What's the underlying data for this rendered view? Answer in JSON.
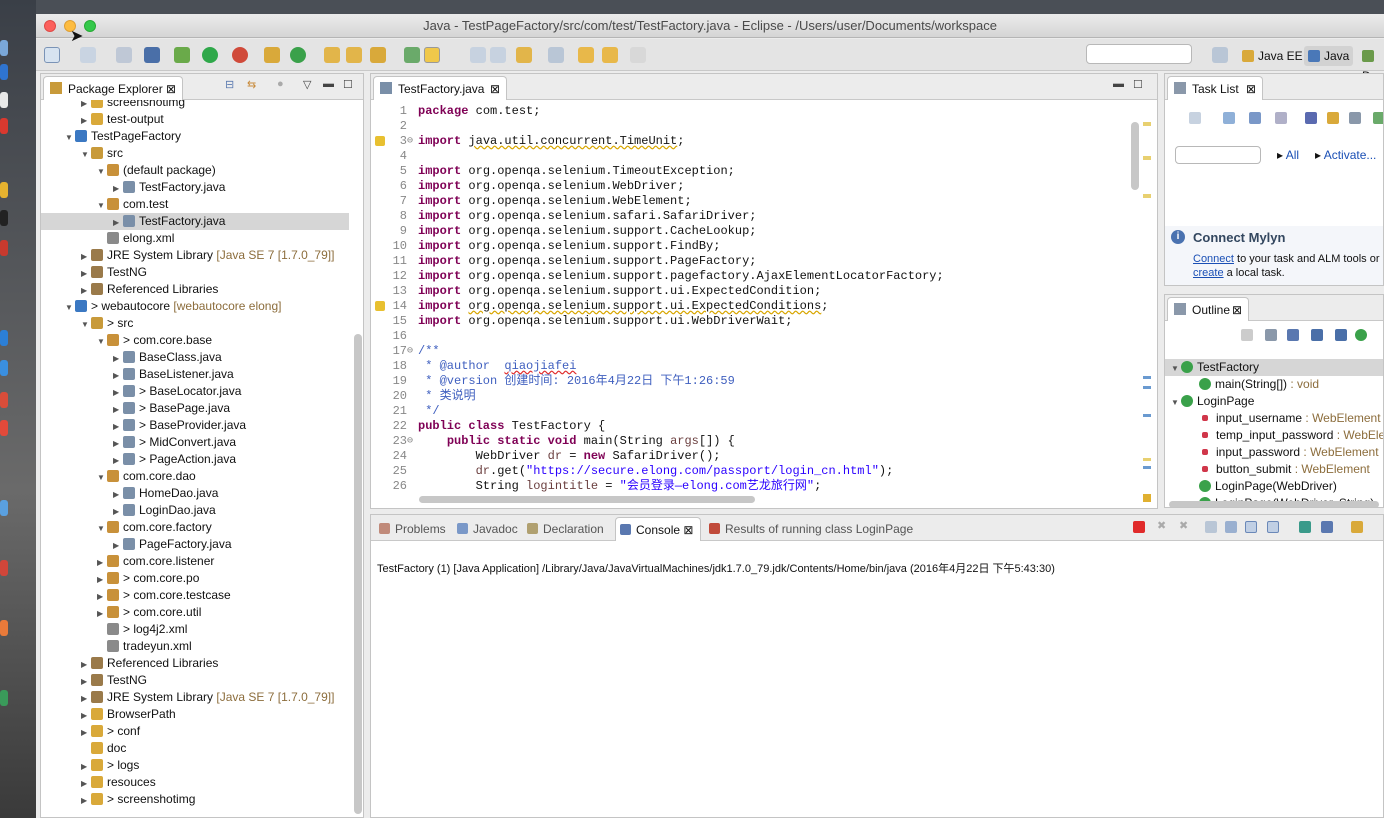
{
  "window": {
    "title": "Java - TestPageFactory/src/com/test/TestFactory.java - Eclipse - /Users/user/Documents/workspace"
  },
  "perspectives": {
    "java_ee": "Java EE",
    "java": "Java"
  },
  "package_explorer": {
    "tab": "Package Explorer",
    "rows": [
      {
        "indent": 2,
        "twisty": "▶",
        "label": "screenshotimg",
        "color": "#d9a93a"
      },
      {
        "indent": 2,
        "twisty": "▶",
        "label": "test-output",
        "color": "#d9a93a"
      },
      {
        "indent": 1,
        "twisty": "▼",
        "label": "TestPageFactory",
        "color": "#3b78c2"
      },
      {
        "indent": 2,
        "twisty": "▼",
        "label": "src",
        "color": "#c89a3a"
      },
      {
        "indent": 3,
        "twisty": "▼",
        "label": "(default package)",
        "color": "#c8913a"
      },
      {
        "indent": 4,
        "twisty": "▶",
        "label": "TestFactory.java",
        "color": "#7a8fa8"
      },
      {
        "indent": 3,
        "twisty": "▼",
        "label": "com.test",
        "color": "#c8913a"
      },
      {
        "indent": 4,
        "twisty": "▶",
        "label": "TestFactory.java",
        "color": "#7a8fa8",
        "selected": true
      },
      {
        "indent": 3,
        "twisty": "",
        "label": "elong.xml",
        "color": "#8a8a8a"
      },
      {
        "indent": 2,
        "twisty": "▶",
        "label": "JRE System Library",
        "deco": "[Java SE 7 [1.7.0_79]]",
        "color": "#9a7a4a"
      },
      {
        "indent": 2,
        "twisty": "▶",
        "label": "TestNG",
        "color": "#9a7a4a"
      },
      {
        "indent": 2,
        "twisty": "▶",
        "label": "Referenced Libraries",
        "color": "#9a7a4a"
      },
      {
        "indent": 1,
        "twisty": "▼",
        "label": "> webautocore",
        "deco": "[webautocore elong]",
        "color": "#3b78c2"
      },
      {
        "indent": 2,
        "twisty": "▼",
        "label": "> src",
        "color": "#c89a3a"
      },
      {
        "indent": 3,
        "twisty": "▼",
        "label": "> com.core.base",
        "color": "#c8913a"
      },
      {
        "indent": 4,
        "twisty": "▶",
        "label": "BaseClass.java",
        "color": "#7a8fa8"
      },
      {
        "indent": 4,
        "twisty": "▶",
        "label": "BaseListener.java",
        "color": "#7a8fa8"
      },
      {
        "indent": 4,
        "twisty": "▶",
        "label": "> BaseLocator.java",
        "color": "#7a8fa8"
      },
      {
        "indent": 4,
        "twisty": "▶",
        "label": "> BasePage.java",
        "color": "#7a8fa8"
      },
      {
        "indent": 4,
        "twisty": "▶",
        "label": "> BaseProvider.java",
        "color": "#7a8fa8"
      },
      {
        "indent": 4,
        "twisty": "▶",
        "label": "> MidConvert.java",
        "color": "#7a8fa8"
      },
      {
        "indent": 4,
        "twisty": "▶",
        "label": "> PageAction.java",
        "color": "#7a8fa8"
      },
      {
        "indent": 3,
        "twisty": "▼",
        "label": "com.core.dao",
        "color": "#c8913a"
      },
      {
        "indent": 4,
        "twisty": "▶",
        "label": "HomeDao.java",
        "color": "#7a8fa8"
      },
      {
        "indent": 4,
        "twisty": "▶",
        "label": "LoginDao.java",
        "color": "#7a8fa8"
      },
      {
        "indent": 3,
        "twisty": "▼",
        "label": "com.core.factory",
        "color": "#c8913a"
      },
      {
        "indent": 4,
        "twisty": "▶",
        "label": "PageFactory.java",
        "color": "#7a8fa8"
      },
      {
        "indent": 3,
        "twisty": "▶",
        "label": "com.core.listener",
        "color": "#c8913a"
      },
      {
        "indent": 3,
        "twisty": "▶",
        "label": "> com.core.po",
        "color": "#c8913a"
      },
      {
        "indent": 3,
        "twisty": "▶",
        "label": "> com.core.testcase",
        "color": "#c8913a"
      },
      {
        "indent": 3,
        "twisty": "▶",
        "label": "> com.core.util",
        "color": "#c8913a"
      },
      {
        "indent": 3,
        "twisty": "",
        "label": "> log4j2.xml",
        "color": "#8a8a8a"
      },
      {
        "indent": 3,
        "twisty": "",
        "label": "tradeyun.xml",
        "color": "#8a8a8a"
      },
      {
        "indent": 2,
        "twisty": "▶",
        "label": "Referenced Libraries",
        "color": "#9a7a4a"
      },
      {
        "indent": 2,
        "twisty": "▶",
        "label": "TestNG",
        "color": "#9a7a4a"
      },
      {
        "indent": 2,
        "twisty": "▶",
        "label": "JRE System Library",
        "deco": "[Java SE 7 [1.7.0_79]]",
        "color": "#9a7a4a"
      },
      {
        "indent": 2,
        "twisty": "▶",
        "label": "BrowserPath",
        "color": "#d9a93a"
      },
      {
        "indent": 2,
        "twisty": "▶",
        "label": "> conf",
        "color": "#d9a93a"
      },
      {
        "indent": 2,
        "twisty": "",
        "label": "doc",
        "color": "#d9a93a"
      },
      {
        "indent": 2,
        "twisty": "▶",
        "label": "> logs",
        "color": "#d9a93a"
      },
      {
        "indent": 2,
        "twisty": "▶",
        "label": "resouces",
        "color": "#d9a93a"
      },
      {
        "indent": 2,
        "twisty": "▶",
        "label": "> screenshotimg",
        "color": "#d9a93a"
      }
    ]
  },
  "editor": {
    "tab": "TestFactory.java",
    "lines": [
      {
        "n": "1",
        "html": "<span class='kw'>package</span> com.test;"
      },
      {
        "n": "2",
        "html": ""
      },
      {
        "n": "3",
        "html": "<span class='kw'>import</span> <span class='wv'>java.util.concurrent.TimeUnit</span>;",
        "fold": "⊖",
        "warn": true
      },
      {
        "n": "4",
        "html": ""
      },
      {
        "n": "5",
        "html": "<span class='kw'>import</span> org.openqa.selenium.TimeoutException;"
      },
      {
        "n": "6",
        "html": "<span class='kw'>import</span> org.openqa.selenium.WebDriver;"
      },
      {
        "n": "7",
        "html": "<span class='kw'>import</span> org.openqa.selenium.WebElement;"
      },
      {
        "n": "8",
        "html": "<span class='kw'>import</span> org.openqa.selenium.safari.SafariDriver;"
      },
      {
        "n": "9",
        "html": "<span class='kw'>import</span> org.openqa.selenium.support.CacheLookup;"
      },
      {
        "n": "10",
        "html": "<span class='kw'>import</span> org.openqa.selenium.support.FindBy;"
      },
      {
        "n": "11",
        "html": "<span class='kw'>import</span> org.openqa.selenium.support.PageFactory;"
      },
      {
        "n": "12",
        "html": "<span class='kw'>import</span> org.openqa.selenium.support.pagefactory.AjaxElementLocatorFactory;"
      },
      {
        "n": "13",
        "html": "<span class='kw'>import</span> org.openqa.selenium.support.ui.ExpectedCondition;"
      },
      {
        "n": "14",
        "html": "<span class='kw'>import</span> <span class='wv'>org.openqa.selenium.support.ui.ExpectedConditions</span>;",
        "warn": true
      },
      {
        "n": "15",
        "html": "<span class='kw'>import</span> org.openqa.selenium.support.ui.WebDriverWait;"
      },
      {
        "n": "16",
        "html": ""
      },
      {
        "n": "17",
        "html": "<span class='cm'>/**</span>",
        "fold": "⊖"
      },
      {
        "n": "18",
        "html": "<span class='cm'> * @author  <span style='text-decoration:underline wavy #e03030'>qiaojiafei</span></span>"
      },
      {
        "n": "19",
        "html": "<span class='cm'> * @version 创建时间: 2016年4月22日 下午1:26:59</span>"
      },
      {
        "n": "20",
        "html": "<span class='cm'> * 类说明</span>"
      },
      {
        "n": "21",
        "html": "<span class='cm'> */</span>"
      },
      {
        "n": "22",
        "html": "<span class='kw'>public class</span> TestFactory {"
      },
      {
        "n": "23",
        "html": "    <span class='kw'>public static void</span> main(String <span style='color:#6a3e3e'>args</span>[]) {",
        "fold": "⊖"
      },
      {
        "n": "24",
        "html": "        WebDriver <span style='color:#6a3e3e'>dr</span> = <span class='kw'>new</span> SafariDriver();"
      },
      {
        "n": "25",
        "html": "        <span style='color:#6a3e3e'>dr</span>.get(<span class='str'>\"https://secure.elong.com/passport/login_cn.html\"</span>);"
      },
      {
        "n": "26",
        "html": "        String <span style='color:#6a3e3e'>logintitle</span> = <span class='str'>\"会员登录—elong.com艺龙旅行网\"</span>;"
      }
    ]
  },
  "task_list": {
    "tab": "Task List",
    "all": "All",
    "activate": "Activate...",
    "connect_title": "Connect Mylyn",
    "connect_link": "Connect",
    "connect_rest": " to your task and ALM tools or",
    "create_link": "create",
    "create_rest": " a local task."
  },
  "outline": {
    "tab": "Outline",
    "items": [
      {
        "indent": 0,
        "twisty": "▼",
        "label": "TestFactory",
        "type": "",
        "color": "#3aa14a",
        "sel": true
      },
      {
        "indent": 1,
        "twisty": "",
        "label": "main(String[])",
        "type": " : void",
        "color": "#3aa14a"
      },
      {
        "indent": 0,
        "twisty": "▼",
        "label": "LoginPage",
        "type": "",
        "color": "#3aa14a"
      },
      {
        "indent": 1,
        "twisty": "",
        "label": "input_username",
        "type": " : WebElement",
        "color": "#d0364a"
      },
      {
        "indent": 1,
        "twisty": "",
        "label": "temp_input_password",
        "type": " : WebElement",
        "color": "#d0364a"
      },
      {
        "indent": 1,
        "twisty": "",
        "label": "input_password",
        "type": " : WebElement",
        "color": "#d0364a"
      },
      {
        "indent": 1,
        "twisty": "",
        "label": "button_submit",
        "type": " : WebElement",
        "color": "#d0364a"
      },
      {
        "indent": 1,
        "twisty": "",
        "label": "LoginPage(WebDriver)",
        "type": "",
        "color": "#3aa14a"
      },
      {
        "indent": 1,
        "twisty": "",
        "label": "LoginPage(WebDriver, String)",
        "type": "",
        "color": "#3aa14a"
      }
    ]
  },
  "bottom": {
    "tabs": [
      "Problems",
      "Javadoc",
      "Declaration",
      "Console",
      "Results of running class LoginPage"
    ],
    "active": 3,
    "console_line": "TestFactory (1) [Java Application] /Library/Java/JavaVirtualMachines/jdk1.7.0_79.jdk/Contents/Home/bin/java (2016年4月22日 下午5:43:30)"
  }
}
